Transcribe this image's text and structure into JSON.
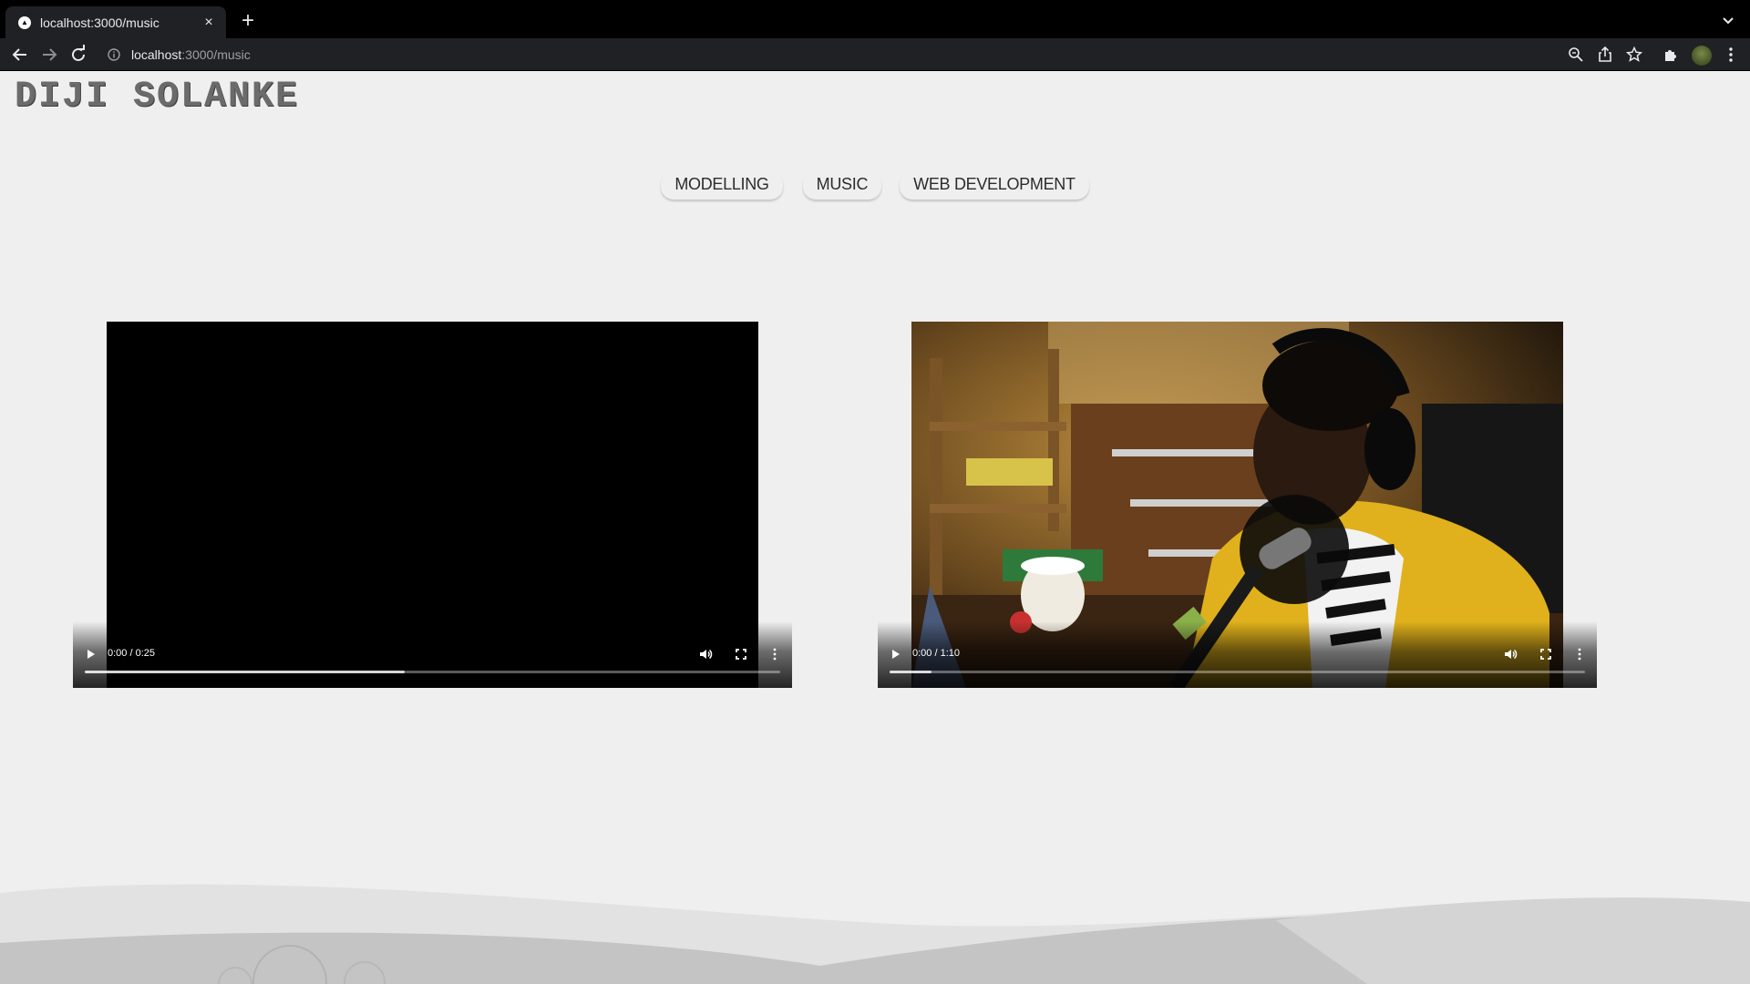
{
  "browser": {
    "tab_title": "localhost:3000/music",
    "new_tab_label": "+",
    "close_label": "×",
    "url_host": "localhost",
    "url_path": ":3000/music"
  },
  "site": {
    "title": "DIJI SOLANKE",
    "nav": [
      {
        "label": "MODELLING"
      },
      {
        "label": "MUSIC"
      },
      {
        "label": "WEB DEVELOPMENT"
      }
    ]
  },
  "videos": [
    {
      "time": "0:00 / 0:25",
      "buffered_fraction": 0.46
    },
    {
      "time": "0:00 / 1:10",
      "buffered_fraction": 0.06
    }
  ],
  "icons": [
    "back-icon",
    "forward-icon",
    "reload-icon",
    "info-icon",
    "zoom-icon",
    "share-icon",
    "star-icon",
    "extensions-icon",
    "kebab-menu-icon",
    "play-icon",
    "volume-icon",
    "fullscreen-icon"
  ]
}
